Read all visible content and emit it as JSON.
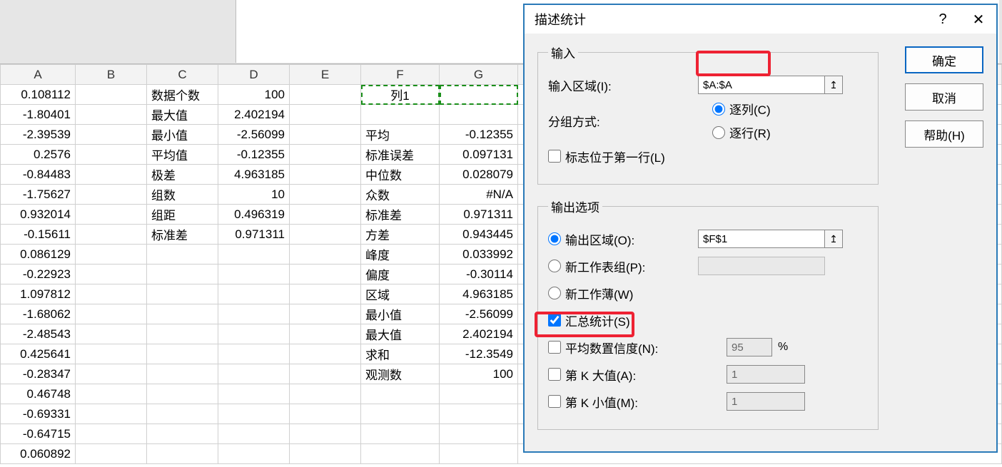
{
  "columns": [
    "A",
    "B",
    "C",
    "D",
    "E",
    "F",
    "G"
  ],
  "colA": [
    "0.108112",
    "-1.80401",
    "-2.39539",
    "0.2576",
    "-0.84483",
    "-1.75627",
    "0.932014",
    "-0.15611",
    "0.086129",
    "-0.22923",
    "1.097812",
    "-1.68062",
    "-2.48543",
    "0.425641",
    "-0.28347",
    "0.46748",
    "-0.69331",
    "-0.64715",
    "0.060892"
  ],
  "colC_labels": [
    "数据个数",
    "最大值",
    "最小值",
    "平均值",
    "极差",
    "组数",
    "组距",
    "标准差"
  ],
  "colD_values": [
    "100",
    "2.402194",
    "-2.56099",
    "-0.12355",
    "4.963185",
    "10",
    "0.496319",
    "0.971311"
  ],
  "f1_header": "列1",
  "colF_labels": [
    "平均",
    "标准误差",
    "中位数",
    "众数",
    "标准差",
    "方差",
    "峰度",
    "偏度",
    "区域",
    "最小值",
    "最大值",
    "求和",
    "观测数"
  ],
  "colG_values": [
    "-0.12355",
    "0.097131",
    "0.028079",
    "#N/A",
    "0.971311",
    "0.943445",
    "0.033992",
    "-0.30114",
    "4.963185",
    "-2.56099",
    "2.402194",
    "-12.3549",
    "100"
  ],
  "dialog": {
    "title": "描述统计",
    "help_char": "?",
    "close_char": "✕",
    "input_legend": "输入",
    "input_range_label": "输入区域(I):",
    "input_range_value": "$A:$A",
    "group_label": "分组方式:",
    "group_by_col": "逐列(C)",
    "group_by_row": "逐行(R)",
    "labels_first_row": "标志位于第一行(L)",
    "output_legend": "输出选项",
    "output_range_label": "输出区域(O):",
    "output_range_value": "$F$1",
    "new_sheet_label": "新工作表组(P):",
    "new_book_label": "新工作薄(W)",
    "summary_label": "汇总统计(S)",
    "conf_label": "平均数置信度(N):",
    "conf_value": "95",
    "pct": "%",
    "kth_large_label": "第 K 大值(A):",
    "kth_large_value": "1",
    "kth_small_label": "第 K 小值(M):",
    "kth_small_value": "1",
    "btn_ok": "确定",
    "btn_cancel": "取消",
    "btn_help": "帮助(H)"
  }
}
